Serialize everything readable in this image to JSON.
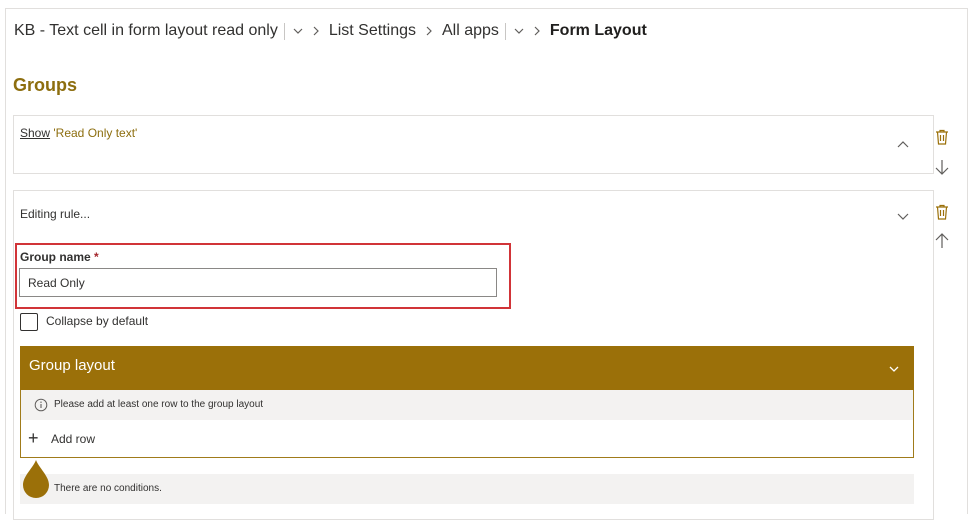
{
  "breadcrumb": {
    "items": [
      "KB - Text cell in form layout read only",
      "List Settings",
      "All apps",
      "Form Layout"
    ]
  },
  "groups": {
    "title": "Groups",
    "cards": [
      {
        "show_link": "Show",
        "rule_text": "'Read Only text'"
      },
      {
        "summary": "Editing rule..."
      }
    ]
  },
  "group_form": {
    "name_label": "Group name",
    "required_mark": "*",
    "name_value": "Read Only",
    "collapse_label": "Collapse by default"
  },
  "group_layout": {
    "title": "Group layout",
    "info": "Please add at least one row to the group layout",
    "add_plus": "+",
    "add_row": "Add row"
  },
  "conditions": {
    "empty_text": "There are no conditions."
  },
  "icons": {
    "breadcrumb_dropdown": "chevron-down-icon",
    "breadcrumb_separator": "chevron-right-icon",
    "collapse": "chevron-up-icon",
    "expand": "chevron-down-icon",
    "delete": "trash-icon",
    "move_down": "arrow-down-icon",
    "move_up": "arrow-up-icon",
    "info": "info-icon",
    "add": "plus-icon",
    "drag_handle": "drop-icon"
  },
  "colors": {
    "accent": "#9b7009",
    "heading": "#8d6e0f",
    "highlight": "#d13438"
  }
}
